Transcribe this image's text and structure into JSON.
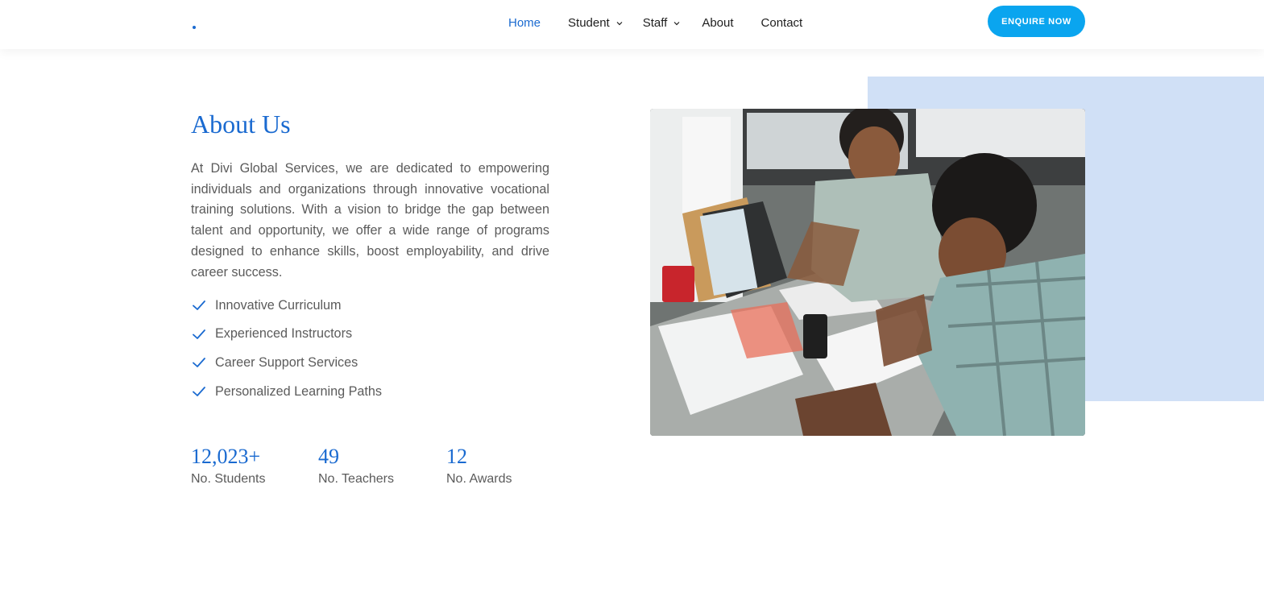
{
  "header": {
    "nav": [
      {
        "label": "Home",
        "active": true
      },
      {
        "label": "Student",
        "dropdown": true
      },
      {
        "label": "Staff",
        "dropdown": true
      },
      {
        "label": "About"
      },
      {
        "label": "Contact"
      }
    ],
    "cta_label": "ENQUIRE NOW"
  },
  "about": {
    "title": "About Us",
    "description": "At Divi Global Services, we are dedicated to empowering individuals and organizations through innovative vocational training solutions. With a vision to bridge the gap between talent and opportunity, we offer a wide range of programs designed to enhance skills, boost employability, and drive career success.",
    "features": [
      "Innovative Curriculum",
      "Experienced Instructors",
      "Career Support Services",
      "Personalized Learning Paths"
    ]
  },
  "stats": [
    {
      "value": "12,023+",
      "label": "No. Students"
    },
    {
      "value": "49",
      "label": "No. Teachers"
    },
    {
      "value": "12",
      "label": "No. Awards"
    }
  ],
  "colors": {
    "accent": "#1a6ad0",
    "cta": "#0aa5ef",
    "panel": "#d0e0f6",
    "body_text": "#5b5b5b"
  },
  "icons": {
    "feature": "check-icon",
    "dropdown": "chevron-down-icon"
  }
}
